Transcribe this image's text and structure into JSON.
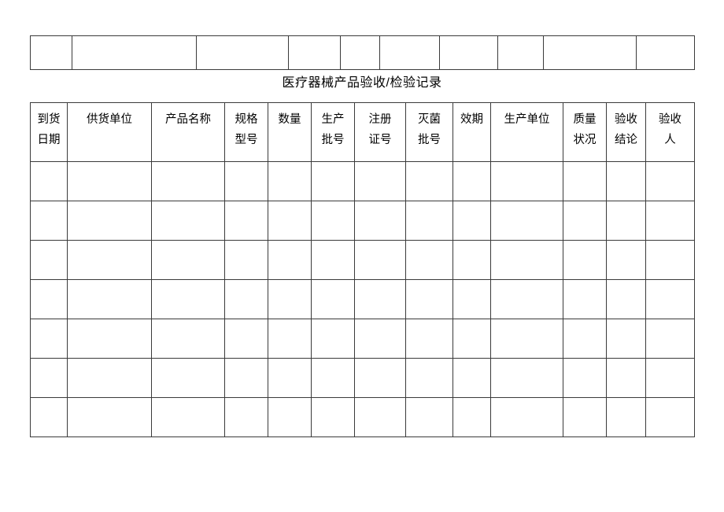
{
  "document": {
    "title": "医疗器械产品验收/检验记录"
  },
  "top_table": {
    "row_count": 1,
    "columns": [
      {
        "name": "top-col-1",
        "value": ""
      },
      {
        "name": "top-col-2",
        "value": ""
      },
      {
        "name": "top-col-3",
        "value": ""
      },
      {
        "name": "top-col-4",
        "value": ""
      },
      {
        "name": "top-col-5",
        "value": ""
      },
      {
        "name": "top-col-6",
        "value": ""
      },
      {
        "name": "top-col-7",
        "value": ""
      },
      {
        "name": "top-col-8",
        "value": ""
      },
      {
        "name": "top-col-9",
        "value": ""
      },
      {
        "name": "top-col-10",
        "value": ""
      },
      {
        "name": "top-col-11",
        "value": ""
      }
    ]
  },
  "main_table": {
    "headers": [
      {
        "line1": "到货",
        "line2": "日期"
      },
      {
        "line1": "供货单位",
        "line2": ""
      },
      {
        "line1": "产品名称",
        "line2": ""
      },
      {
        "line1": "规格",
        "line2": "型号"
      },
      {
        "line1": "数量",
        "line2": ""
      },
      {
        "line1": "生产",
        "line2": "批号"
      },
      {
        "line1": "注册",
        "line2": "证号"
      },
      {
        "line1": "灭菌",
        "line2": "批号"
      },
      {
        "line1": "效期",
        "line2": ""
      },
      {
        "line1": "生产单位",
        "line2": ""
      },
      {
        "line1": "质量",
        "line2": "状况"
      },
      {
        "line1": "验收",
        "line2": "结论"
      },
      {
        "line1": "验收",
        "line2": "人"
      }
    ],
    "rows": [
      [
        "",
        "",
        "",
        "",
        "",
        "",
        "",
        "",
        "",
        "",
        "",
        "",
        ""
      ],
      [
        "",
        "",
        "",
        "",
        "",
        "",
        "",
        "",
        "",
        "",
        "",
        "",
        ""
      ],
      [
        "",
        "",
        "",
        "",
        "",
        "",
        "",
        "",
        "",
        "",
        "",
        "",
        ""
      ],
      [
        "",
        "",
        "",
        "",
        "",
        "",
        "",
        "",
        "",
        "",
        "",
        "",
        ""
      ],
      [
        "",
        "",
        "",
        "",
        "",
        "",
        "",
        "",
        "",
        "",
        "",
        "",
        ""
      ],
      [
        "",
        "",
        "",
        "",
        "",
        "",
        "",
        "",
        "",
        "",
        "",
        "",
        ""
      ],
      [
        "",
        "",
        "",
        "",
        "",
        "",
        "",
        "",
        "",
        "",
        "",
        "",
        ""
      ]
    ]
  },
  "style": {
    "background": "#ffffff",
    "border_color": "#3a3a3a",
    "text_color": "#000000"
  }
}
